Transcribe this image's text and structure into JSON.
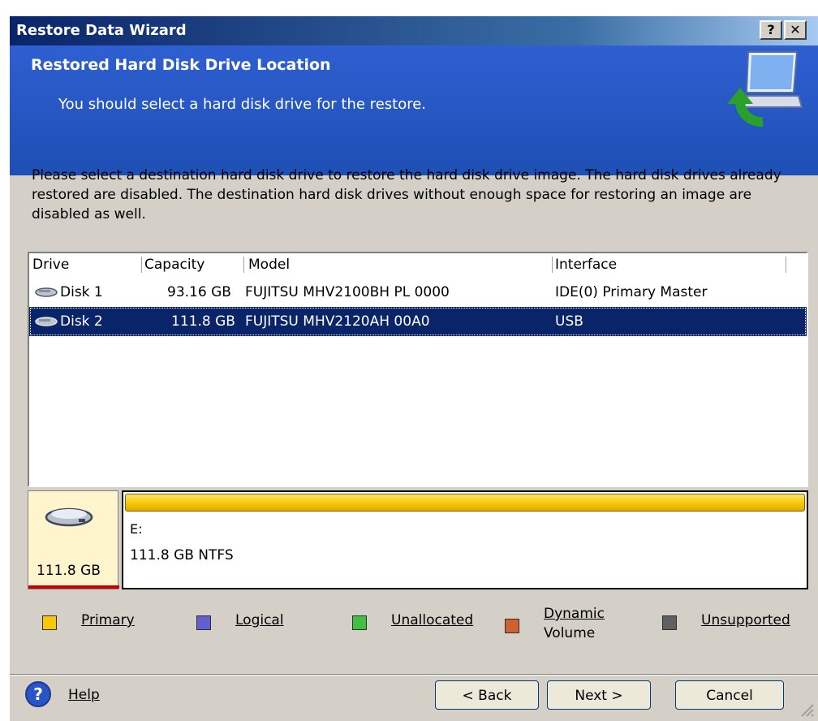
{
  "window": {
    "title": "Restore Data Wizard",
    "help_glyph": "?",
    "close_glyph": "✕"
  },
  "header": {
    "title": "Restored Hard Disk Drive Location",
    "subtitle": "You should select a hard disk drive for the restore.",
    "icon": "monitor-restore-icon"
  },
  "instruction": "Please select a destination hard disk drive to restore the hard disk drive image. The hard disk drives already restored are disabled. The destination hard disk drives without enough space for restoring an image are disabled as well.",
  "drive_list": {
    "columns": [
      "Drive",
      "Capacity",
      "Model",
      "Interface"
    ],
    "rows": [
      {
        "drive": "Disk 1",
        "capacity": "93.16 GB",
        "model": "FUJITSU MHV2100BH PL 0000",
        "interface": "IDE(0) Primary Master",
        "selected": false
      },
      {
        "drive": "Disk 2",
        "capacity": "111.8 GB",
        "model": "FUJITSU MHV2120AH 00A0",
        "interface": "USB",
        "selected": true
      }
    ]
  },
  "disk_map": {
    "disk_size": "111.8 GB",
    "partition_letter": "E:",
    "partition_desc": "111.8 GB  NTFS"
  },
  "legend": {
    "primary": "Primary",
    "logical": "Logical",
    "unallocated": "Unallocated",
    "dynamic_line1": "Dynamic",
    "dynamic_line2": "Volume",
    "unsupported": "Unsupported",
    "colors": {
      "primary": "#f8c800",
      "logical": "#6060d0",
      "unallocated": "#40c040",
      "dynamic": "#d06030",
      "unsupported": "#606060"
    }
  },
  "footer": {
    "help_label": "Help",
    "back_label": "< Back",
    "next_label": "Next >",
    "cancel_label": "Cancel"
  }
}
